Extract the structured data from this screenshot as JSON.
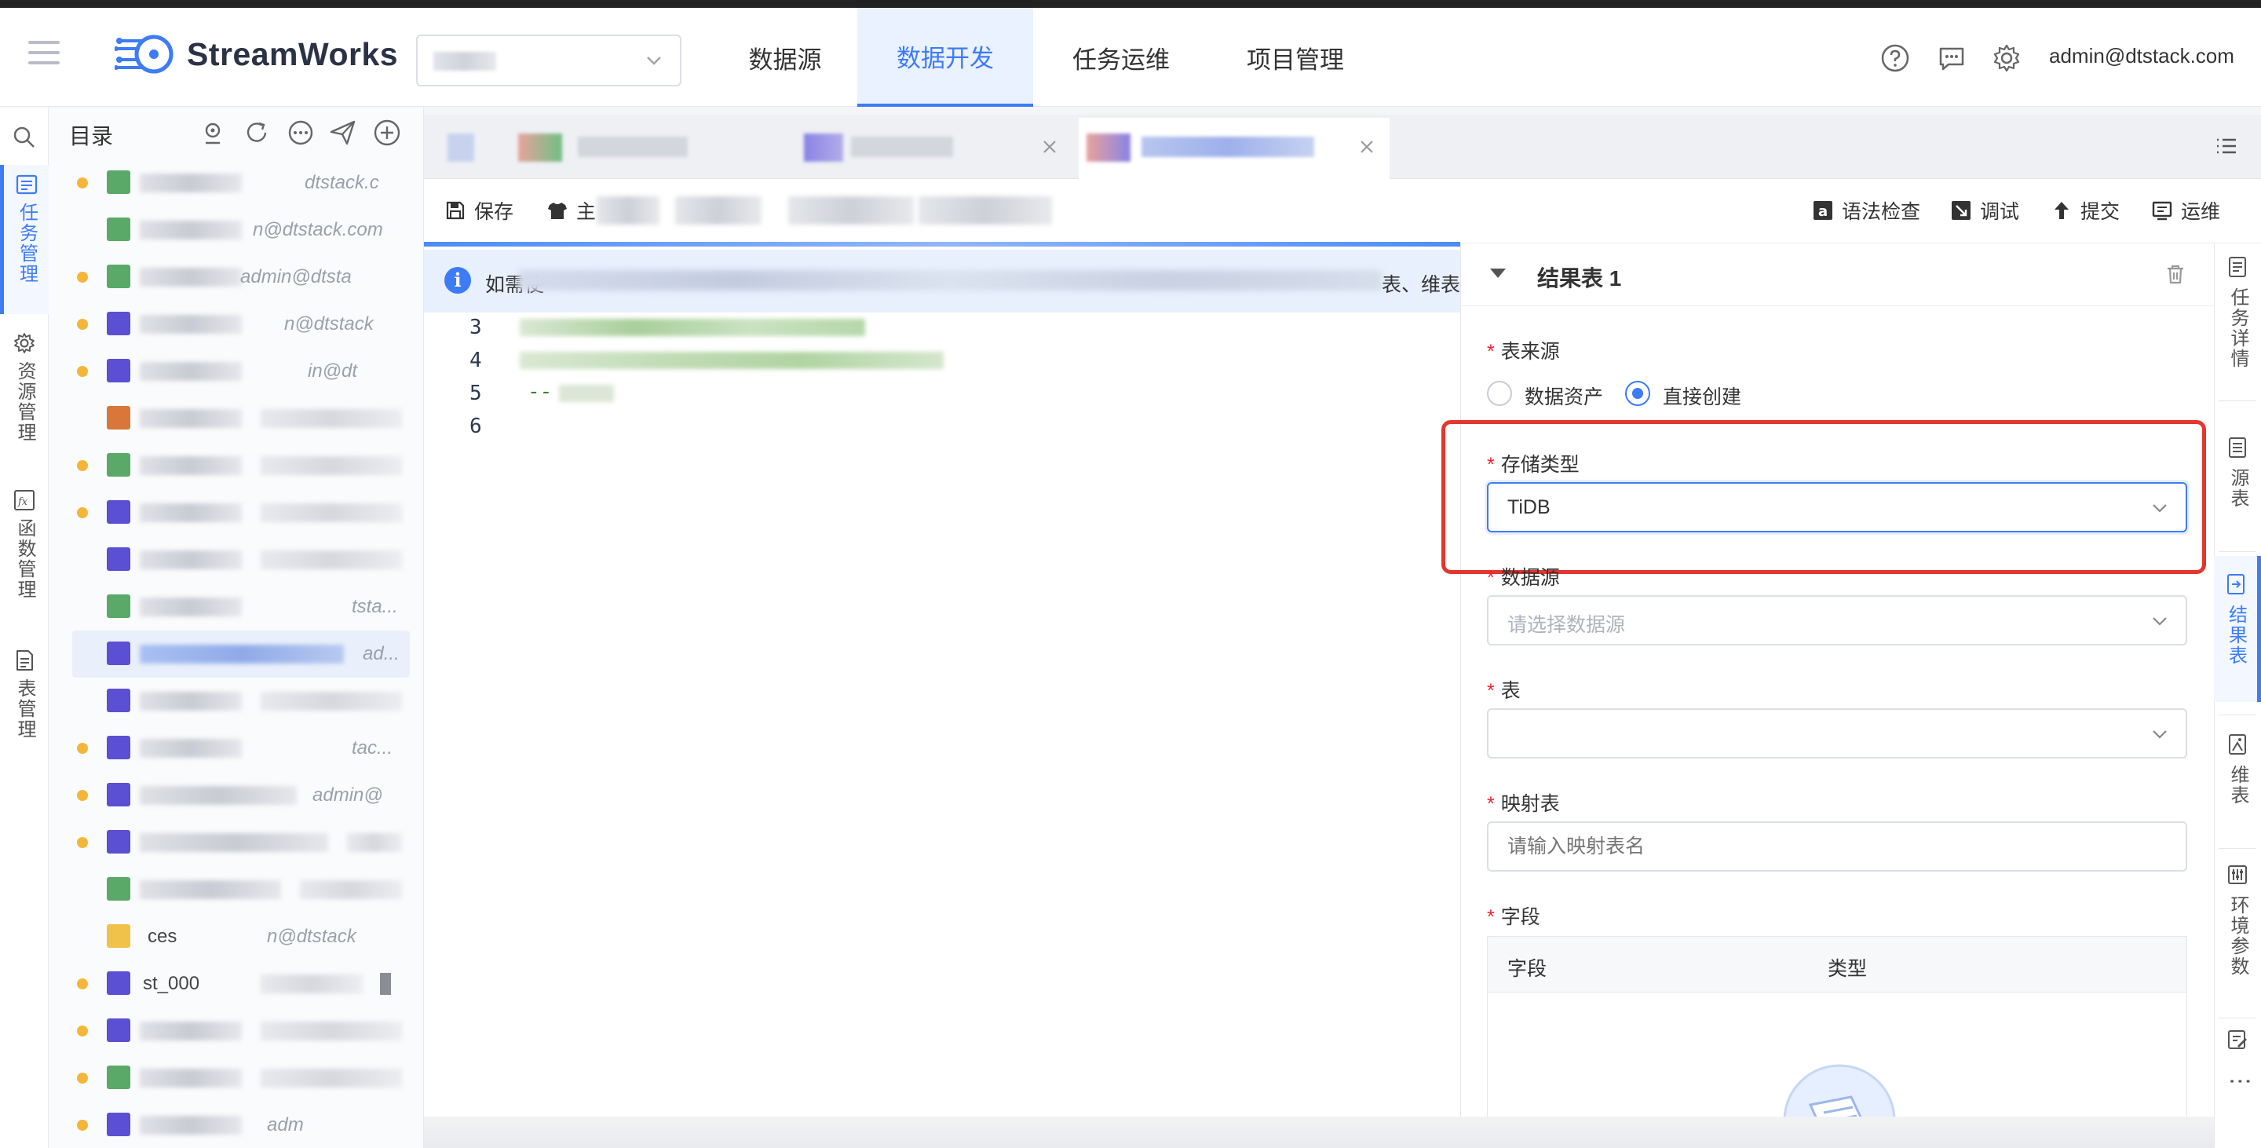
{
  "app": {
    "name": "StreamWorks",
    "user": "admin@dtstack.com"
  },
  "nav": {
    "items": [
      {
        "label": "数据源"
      },
      {
        "label": "数据开发"
      },
      {
        "label": "任务运维"
      },
      {
        "label": "项目管理"
      }
    ],
    "active": "数据开发"
  },
  "left_rail": {
    "items": [
      {
        "label": "任务管理",
        "icon": "task-icon"
      },
      {
        "label": "资源管理",
        "icon": "gear-icon"
      },
      {
        "label": "函数管理",
        "icon": "function-icon"
      },
      {
        "label": "表管理",
        "icon": "table-icon"
      }
    ]
  },
  "tree": {
    "title": "目录",
    "partial_texts": {
      "r1": "dtstack.c",
      "r2": "n@dtstack.com",
      "r3": "admin@dtsta",
      "r4": "n@dtstack",
      "r5": "in@dt",
      "r11": "ad...",
      "r19": "ces",
      "r20": "n@dtstack",
      "r21": "st_000",
      "r24": "adm",
      "r10": "tsta...",
      "r13": "tac...",
      "r15": "admin@"
    }
  },
  "toolbar": {
    "save": "保存",
    "theme_partial": "主",
    "syntax_check": "语法检查",
    "debug": "调试",
    "submit": "提交",
    "ops": "运维"
  },
  "notice": {
    "prefix": "如需使",
    "suffix": "表、维表"
  },
  "editor": {
    "line_numbers": [
      "3",
      "4",
      "5",
      "6"
    ],
    "comment_prefix": "--"
  },
  "result_panel": {
    "title": "结果表 1",
    "source_label": "表来源",
    "source_options": [
      "数据资产",
      "直接创建"
    ],
    "source_selected": "直接创建",
    "storage_label": "存储类型",
    "storage_value": "TiDB",
    "datasource_label": "数据源",
    "datasource_placeholder": "请选择数据源",
    "table_label": "表",
    "table_value": "",
    "mapping_label": "映射表",
    "mapping_placeholder": "请输入映射表名",
    "fields_label": "字段",
    "fields_columns": [
      "字段",
      "类型"
    ]
  },
  "side_rail": {
    "items": [
      {
        "label": "任务详情",
        "icon": "doc-icon"
      },
      {
        "label": "源表",
        "icon": "source-table-icon"
      },
      {
        "label": "结果表",
        "icon": "result-table-icon"
      },
      {
        "label": "维表",
        "icon": "dim-table-icon"
      },
      {
        "label": "环境参数",
        "icon": "sliders-icon"
      }
    ],
    "more": "⋮"
  },
  "colors": {
    "accent": "#3d7bf7",
    "highlight": "#e2362f",
    "pending_dot": "#f4b63a"
  }
}
